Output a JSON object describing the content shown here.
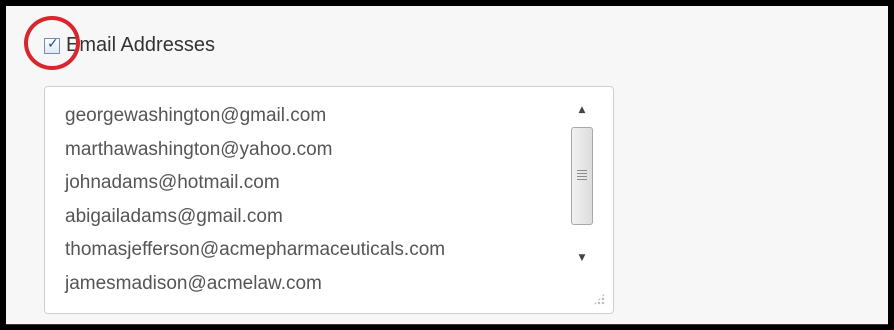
{
  "email_option": {
    "checked": true,
    "label": "Email Addresses"
  },
  "email_textbox": {
    "lines": [
      "georgewashington@gmail.com",
      "marthawashington@yahoo.com",
      "johnadams@hotmail.com",
      "abigailadams@gmail.com",
      "thomasjefferson@acmepharmaceuticals.com",
      "jamesmadison@acmelaw.com"
    ]
  },
  "icons": {
    "checkmark": "check-icon",
    "scroll_up": "scroll-up-arrow-icon",
    "scroll_down": "scroll-down-arrow-icon",
    "resize": "resize-grip-icon"
  },
  "colors": {
    "highlight_circle": "#d8262e",
    "checkbox_border": "#6f8fb5",
    "text": "#555555"
  }
}
